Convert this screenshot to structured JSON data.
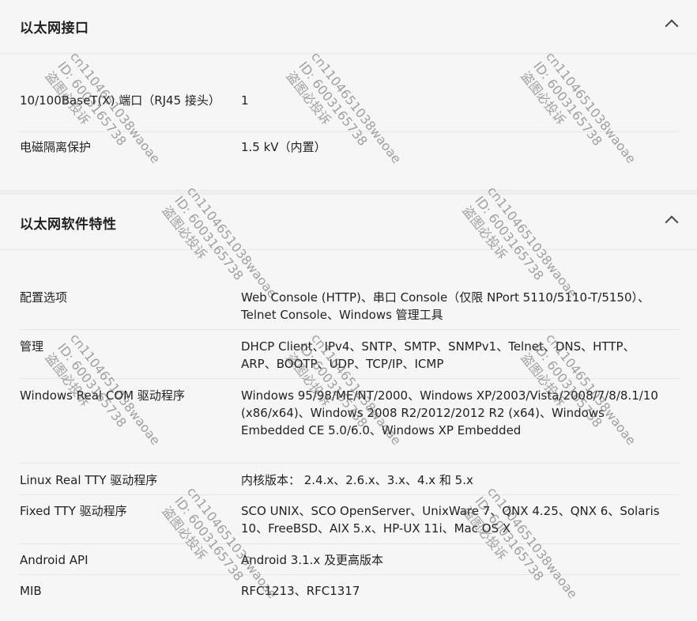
{
  "sections": [
    {
      "title": "以太网接口",
      "rows": [
        {
          "label": "10/100BaseT(X) 端口（RJ45 接头）",
          "value": "1"
        },
        {
          "label": "电磁隔离保护",
          "value": "1.5 kV（内置）"
        }
      ]
    },
    {
      "title": "以太网软件特性",
      "rows": [
        {
          "label": "配置选项",
          "value": "Web Console (HTTP)、串口 Console（仅限 NPort 5110/5110-T/5150）、Telnet Console、Windows 管理工具"
        },
        {
          "label": "管理",
          "value": "DHCP Client、IPv4、SNTP、SMTP、SNMPv1、Telnet、DNS、HTTP、ARP、BOOTP、UDP、TCP/IP、ICMP"
        },
        {
          "label": "Windows Real COM 驱动程序",
          "value": "Windows 95/98/ME/NT/2000、Windows XP/2003/Vista/2008/7/8/8.1/10 (x86/x64)、Windows 2008 R2/2012/2012 R2 (x64)、Windows Embedded CE 5.0/6.0、Windows XP Embedded"
        },
        {
          "label": "Linux Real TTY 驱动程序",
          "value": "内核版本： 2.4.x、2.6.x、3.x、4.x 和 5.x"
        },
        {
          "label": "Fixed TTY 驱动程序",
          "value": "SCO UNIX、SCO OpenServer、UnixWare 7、QNX 4.25、QNX 6、Solaris 10、FreeBSD、AIX 5.x、HP-UX 11i、Mac OS X"
        },
        {
          "label": "Android API",
          "value": "Android 3.1.x 及更高版本"
        },
        {
          "label": "MIB",
          "value": "RFC1213、RFC1317"
        }
      ]
    }
  ],
  "watermark": {
    "line1": "cn1104651038waoae",
    "line2": "ID: 6003165738",
    "line3": "盗图必投诉"
  }
}
